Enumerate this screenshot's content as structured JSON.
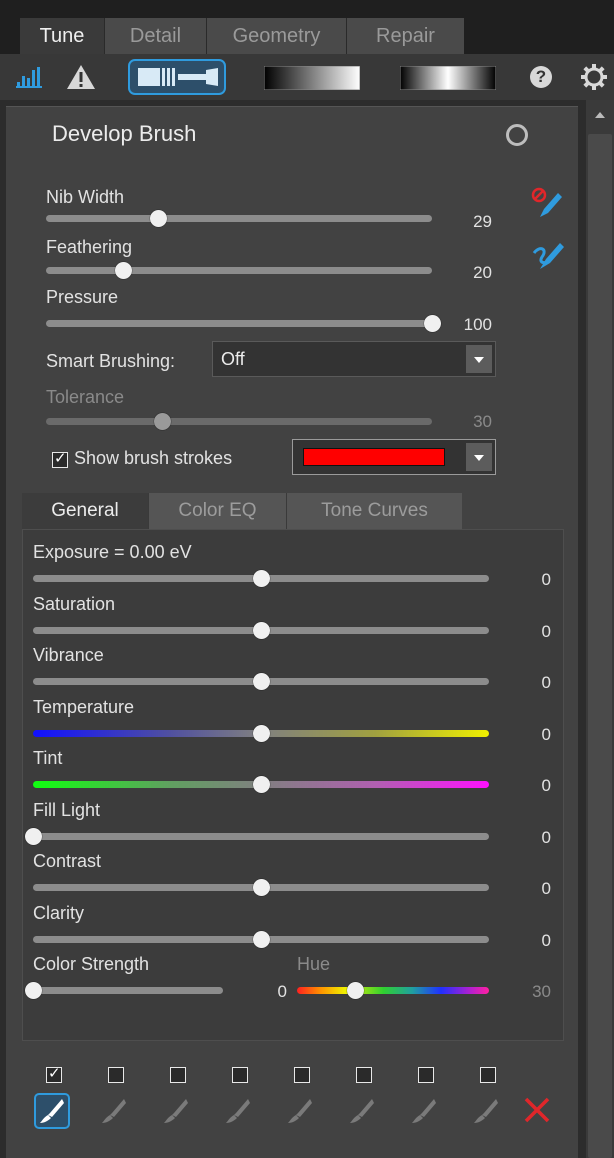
{
  "tabs": [
    {
      "label": "Tune",
      "active": true
    },
    {
      "label": "Detail",
      "active": false
    },
    {
      "label": "Geometry",
      "active": false
    },
    {
      "label": "Repair",
      "active": false
    }
  ],
  "toolbar": {
    "icons": [
      "histogram-icon",
      "warning-icon",
      "brush-tool-icon",
      "gradient-tool-icon",
      "radial-tool-icon",
      "help-icon",
      "gear-icon"
    ],
    "help_glyph": "?"
  },
  "brush": {
    "title": "Develop Brush",
    "nib_width": {
      "label": "Nib Width",
      "value": "29",
      "fraction": 0.29
    },
    "feathering": {
      "label": "Feathering",
      "value": "20",
      "fraction": 0.2
    },
    "pressure": {
      "label": "Pressure",
      "value": "100",
      "fraction": 1.0
    },
    "smart_brushing": {
      "label": "Smart Brushing:",
      "value": "Off"
    },
    "tolerance": {
      "label": "Tolerance",
      "value": "30",
      "fraction": 0.3,
      "enabled": false
    },
    "show_strokes": {
      "label": "Show brush strokes",
      "checked": true,
      "color": "#ff0000"
    }
  },
  "subtabs": [
    {
      "label": "General",
      "active": true
    },
    {
      "label": "Color EQ",
      "active": false
    },
    {
      "label": "Tone Curves",
      "active": false
    }
  ],
  "general": {
    "sliders": [
      {
        "label": "Exposure = 0.00 eV",
        "value": "0",
        "fraction": 0.5
      },
      {
        "label": "Saturation",
        "value": "0",
        "fraction": 0.5
      },
      {
        "label": "Vibrance",
        "value": "0",
        "fraction": 0.5
      },
      {
        "label": "Temperature",
        "value": "0",
        "fraction": 0.5
      },
      {
        "label": "Tint",
        "value": "0",
        "fraction": 0.5
      },
      {
        "label": "Fill Light",
        "value": "0",
        "fraction": 0.0
      },
      {
        "label": "Contrast",
        "value": "0",
        "fraction": 0.5
      },
      {
        "label": "Clarity",
        "value": "0",
        "fraction": 0.5
      }
    ],
    "color_strength": {
      "label": "Color Strength",
      "value": "0",
      "fraction": 0.0
    },
    "hue": {
      "label": "Hue",
      "value": "30",
      "fraction": 0.3
    }
  },
  "brush_slots": {
    "count": 8,
    "checked": [
      true,
      false,
      false,
      false,
      false,
      false,
      false,
      false
    ],
    "active_index": 0
  },
  "colors": {
    "accent": "#2f9bde",
    "stroke_color": "#ff0000",
    "delete": "#e0262a"
  }
}
